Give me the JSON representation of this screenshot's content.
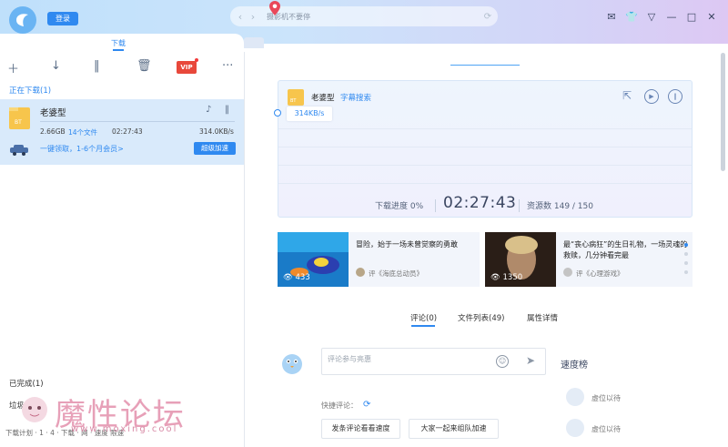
{
  "colors": {
    "accent": "#2f89f0",
    "vip": "#e8483b",
    "folder": "#f7c54c"
  },
  "header": {
    "login_label": "登录",
    "search_placeholder": "摄影机不要停",
    "window_controls": [
      "mail-icon",
      "shirt-icon",
      "menu-icon",
      "minimize-icon",
      "maximize-icon",
      "close-icon"
    ]
  },
  "left": {
    "tab_label": "下载",
    "toolbar": [
      "add-icon",
      "download-icon",
      "pause-icon",
      "delete-icon",
      "vip-icon",
      "more-icon"
    ],
    "vip_label": "VIP",
    "downloading_label": "正在下载(1)",
    "task": {
      "name": "老婆型",
      "file_type": "BT",
      "size": "2.66GB",
      "file_count": "14个文件",
      "remaining_time": "02:27:43",
      "speed": "314.0KB/s",
      "progress": 0,
      "promo_text": "一键领取，1-6个月会员>",
      "speedup_label": "超级加速"
    },
    "completed_label": "已完成(1)",
    "trash_label": "垃圾箱",
    "footer_text": "下载计划  ·  1  ·  4  ·  下载  ·  网  ·  速度 限速"
  },
  "watermark": {
    "big": "魔性论坛",
    "url": "www.moxing.cool"
  },
  "detail": {
    "file_type": "BT",
    "name": "老婆型",
    "subtitle_search": "字幕搜索",
    "speed": "314KB/s",
    "progress_label": "下载进度 0%",
    "time": "02:27:43",
    "resources": "资源数 149 / 150"
  },
  "cards": [
    {
      "title": "冒险，始于一场未曾觉察的勇敢",
      "views": "433",
      "source": "评《海底总动员》"
    },
    {
      "title": "最“丧心病狂”的生日礼物，一场灵魂的救赎，几分钟看完最",
      "views": "1350",
      "source": "评《心理游戏》"
    }
  ],
  "tabs": [
    {
      "label": "评论(0)"
    },
    {
      "label": "文件列表(49)"
    },
    {
      "label": "属性详情"
    }
  ],
  "comment": {
    "placeholder": "评论参与亮惠",
    "quick_label": "快捷评论：",
    "quick_buttons": [
      "发条评论看看速度",
      "大家一起来组队加速"
    ]
  },
  "rank": {
    "title": "速度榜",
    "entries": [
      {
        "name": "虚位以待"
      },
      {
        "name": "虚位以待"
      }
    ]
  }
}
